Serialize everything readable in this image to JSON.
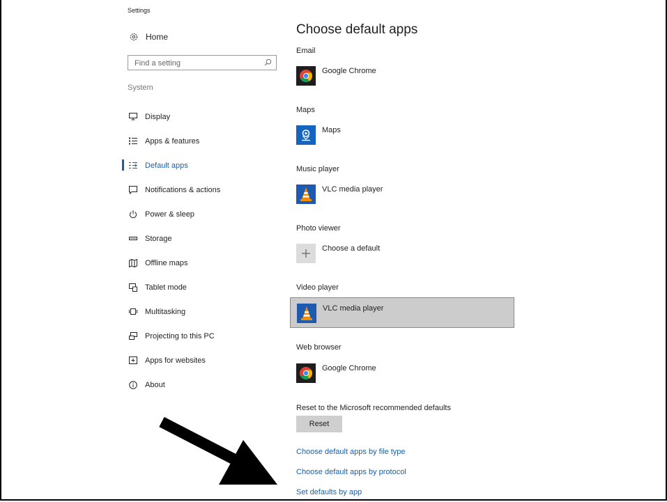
{
  "window": {
    "title": "Settings"
  },
  "sidebar": {
    "home_label": "Home",
    "search_placeholder": "Find a setting",
    "section_label": "System",
    "items": [
      {
        "label": "Display",
        "icon": "monitor-icon"
      },
      {
        "label": "Apps & features",
        "icon": "list-icon"
      },
      {
        "label": "Default apps",
        "icon": "default-apps-icon",
        "active": true
      },
      {
        "label": "Notifications & actions",
        "icon": "message-icon"
      },
      {
        "label": "Power & sleep",
        "icon": "power-icon"
      },
      {
        "label": "Storage",
        "icon": "drive-icon"
      },
      {
        "label": "Offline maps",
        "icon": "map-icon"
      },
      {
        "label": "Tablet mode",
        "icon": "tablet-icon"
      },
      {
        "label": "Multitasking",
        "icon": "multitasking-icon"
      },
      {
        "label": "Projecting to this PC",
        "icon": "projector-icon"
      },
      {
        "label": "Apps for websites",
        "icon": "web-app-icon"
      },
      {
        "label": "About",
        "icon": "info-icon"
      }
    ]
  },
  "main": {
    "title": "Choose default apps",
    "categories": [
      {
        "label": "Email",
        "app": "Google Chrome",
        "icon": "chrome-icon"
      },
      {
        "label": "Maps",
        "app": "Maps",
        "icon": "maps-icon"
      },
      {
        "label": "Music player",
        "app": "VLC media player",
        "icon": "vlc-icon"
      },
      {
        "label": "Photo viewer",
        "app": "Choose a default",
        "icon": "plus-icon"
      },
      {
        "label": "Video player",
        "app": "VLC media player",
        "icon": "vlc-icon",
        "selected": true
      },
      {
        "label": "Web browser",
        "app": "Google Chrome",
        "icon": "chrome-icon"
      }
    ],
    "reset_label": "Reset to the Microsoft recommended defaults",
    "reset_button": "Reset",
    "links": [
      "Choose default apps by file type",
      "Choose default apps by protocol",
      "Set defaults by app"
    ]
  },
  "colors": {
    "accent": "#1a5fa8",
    "selected_bg": "#cccccc",
    "maps_tile": "#1565c0",
    "vlc_orange": "#f28c00"
  }
}
